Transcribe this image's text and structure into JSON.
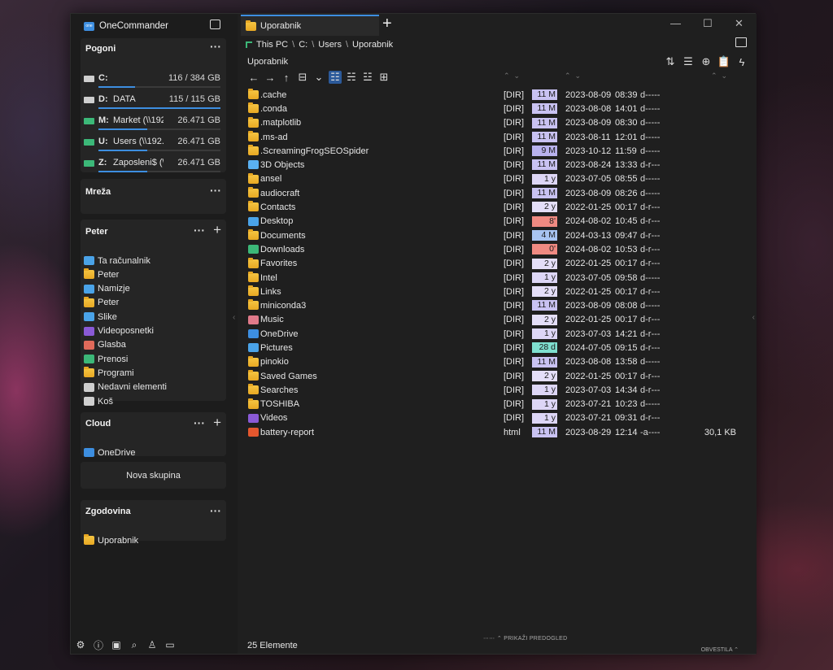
{
  "app": {
    "title": "OneCommander",
    "logo_text": "one"
  },
  "drives_group": {
    "title": "Pogoni",
    "drives": [
      {
        "letter": "C:",
        "name": "",
        "size": "116 / 384 GB",
        "fill": 0.3
      },
      {
        "letter": "D:",
        "name": "DATA",
        "size": "115 / 115 GB",
        "fill": 1.0
      },
      {
        "letter": "M:",
        "name": "Market (\\\\192.1...",
        "size": "26.471 GB",
        "fill": 0.4
      },
      {
        "letter": "U:",
        "name": "Users (\\\\192.168...",
        "size": "26.471 GB",
        "fill": 0.4
      },
      {
        "letter": "Z:",
        "name": "Zaposleni$ (\\\\1...",
        "size": "26.471 GB",
        "fill": 0.4
      }
    ]
  },
  "network_group": {
    "title": "Mreža"
  },
  "user_group": {
    "title": "Peter",
    "items": [
      {
        "label": "Ta računalnik",
        "icon": "monitor-icon",
        "color": "#4aa3e8"
      },
      {
        "label": "Peter",
        "icon": "folder-icon",
        "color": "#f2b632"
      },
      {
        "label": "Namizje",
        "icon": "desktop-icon",
        "color": "#4aa3e8"
      },
      {
        "label": "Peter",
        "icon": "folder-icon",
        "color": "#f2b632"
      },
      {
        "label": "Slike",
        "icon": "pictures-icon",
        "color": "#4aa3e8"
      },
      {
        "label": "Videoposnetki",
        "icon": "videos-icon",
        "color": "#8a5ad6"
      },
      {
        "label": "Glasba",
        "icon": "music-icon",
        "color": "#e06a5a"
      },
      {
        "label": "Prenosi",
        "icon": "downloads-icon",
        "color": "#3cb878"
      },
      {
        "label": "Programi",
        "icon": "folder-icon",
        "color": "#f2b632"
      },
      {
        "label": "Nedavni elementi",
        "icon": "recent-icon",
        "color": "#cfcfcf"
      },
      {
        "label": "Koš",
        "icon": "recycle-bin-icon",
        "color": "#cfcfcf"
      }
    ]
  },
  "cloud_group": {
    "title": "Cloud",
    "items": [
      {
        "label": "OneDrive",
        "icon": "onedrive-icon",
        "color": "#3d8ee0"
      }
    ]
  },
  "new_group_label": "Nova skupina",
  "history_group": {
    "title": "Zgodovina",
    "items": [
      {
        "label": "Uporabnik",
        "icon": "folder-icon",
        "color": "#f2b632"
      }
    ]
  },
  "tab": {
    "label": "Uporabnik"
  },
  "breadcrumb": [
    "This PC",
    "C:",
    "Users",
    "Uporabnik"
  ],
  "pane_title": "Uporabnik",
  "files": [
    {
      "name": ".cache",
      "type": "[DIR]",
      "age": "11 M",
      "age_color": "#c9c2f2",
      "date": "2023-08-09",
      "time": "08:39",
      "attr": "d-----",
      "size": "",
      "icon": "folder"
    },
    {
      "name": ".conda",
      "type": "[DIR]",
      "age": "11 M",
      "age_color": "#c9c2f2",
      "date": "2023-08-08",
      "time": "14:01",
      "attr": "d-----",
      "size": "",
      "icon": "folder"
    },
    {
      "name": ".matplotlib",
      "type": "[DIR]",
      "age": "11 M",
      "age_color": "#c9c2f2",
      "date": "2023-08-09",
      "time": "08:30",
      "attr": "d-----",
      "size": "",
      "icon": "folder"
    },
    {
      "name": ".ms-ad",
      "type": "[DIR]",
      "age": "11 M",
      "age_color": "#c9c2f2",
      "date": "2023-08-11",
      "time": "12:01",
      "attr": "d-----",
      "size": "",
      "icon": "folder"
    },
    {
      "name": ".ScreamingFrogSEOSpider",
      "type": "[DIR]",
      "age": "9 M",
      "age_color": "#b9b2ee",
      "date": "2023-10-12",
      "time": "11:59",
      "attr": "d-----",
      "size": "",
      "icon": "folder"
    },
    {
      "name": "3D Objects",
      "type": "[DIR]",
      "age": "11 M",
      "age_color": "#c9c2f2",
      "date": "2023-08-24",
      "time": "13:33",
      "attr": "d-r---",
      "size": "",
      "icon": "3d"
    },
    {
      "name": "ansel",
      "type": "[DIR]",
      "age": "1 y",
      "age_color": "#ddd6f6",
      "date": "2023-07-05",
      "time": "08:55",
      "attr": "d-----",
      "size": "",
      "icon": "folder"
    },
    {
      "name": "audiocraft",
      "type": "[DIR]",
      "age": "11 M",
      "age_color": "#c9c2f2",
      "date": "2023-08-09",
      "time": "08:26",
      "attr": "d-----",
      "size": "",
      "icon": "folder"
    },
    {
      "name": "Contacts",
      "type": "[DIR]",
      "age": "2 y",
      "age_color": "#e4def8",
      "date": "2022-01-25",
      "time": "00:17",
      "attr": "d-r---",
      "size": "",
      "icon": "folder"
    },
    {
      "name": "Desktop",
      "type": "[DIR]",
      "age": "8'",
      "age_color": "#f08a82",
      "date": "2024-08-02",
      "time": "10:45",
      "attr": "d-r---",
      "size": "",
      "icon": "desktop"
    },
    {
      "name": "Documents",
      "type": "[DIR]",
      "age": "4 M",
      "age_color": "#a8c4f2",
      "date": "2024-03-13",
      "time": "09:47",
      "attr": "d-r---",
      "size": "",
      "icon": "folder"
    },
    {
      "name": "Downloads",
      "type": "[DIR]",
      "age": "0'",
      "age_color": "#f08a82",
      "date": "2024-08-02",
      "time": "10:53",
      "attr": "d-r---",
      "size": "",
      "icon": "download"
    },
    {
      "name": "Favorites",
      "type": "[DIR]",
      "age": "2 y",
      "age_color": "#e4def8",
      "date": "2022-01-25",
      "time": "00:17",
      "attr": "d-r---",
      "size": "",
      "icon": "folder"
    },
    {
      "name": "Intel",
      "type": "[DIR]",
      "age": "1 y",
      "age_color": "#ddd6f6",
      "date": "2023-07-05",
      "time": "09:58",
      "attr": "d-----",
      "size": "",
      "icon": "folder"
    },
    {
      "name": "Links",
      "type": "[DIR]",
      "age": "2 y",
      "age_color": "#e4def8",
      "date": "2022-01-25",
      "time": "00:17",
      "attr": "d-r---",
      "size": "",
      "icon": "folder"
    },
    {
      "name": "miniconda3",
      "type": "[DIR]",
      "age": "11 M",
      "age_color": "#c9c2f2",
      "date": "2023-08-09",
      "time": "08:08",
      "attr": "d-----",
      "size": "",
      "icon": "folder"
    },
    {
      "name": "Music",
      "type": "[DIR]",
      "age": "2 y",
      "age_color": "#e4def8",
      "date": "2022-01-25",
      "time": "00:17",
      "attr": "d-r---",
      "size": "",
      "icon": "music"
    },
    {
      "name": "OneDrive",
      "type": "[DIR]",
      "age": "1 y",
      "age_color": "#ddd6f6",
      "date": "2023-07-03",
      "time": "14:21",
      "attr": "d-r---",
      "size": "",
      "icon": "onedrive"
    },
    {
      "name": "Pictures",
      "type": "[DIR]",
      "age": "28 d",
      "age_color": "#7fe0d0",
      "date": "2024-07-05",
      "time": "09:15",
      "attr": "d-r---",
      "size": "",
      "icon": "pictures"
    },
    {
      "name": "pinokio",
      "type": "[DIR]",
      "age": "11 M",
      "age_color": "#c9c2f2",
      "date": "2023-08-08",
      "time": "13:58",
      "attr": "d-----",
      "size": "",
      "icon": "folder"
    },
    {
      "name": "Saved Games",
      "type": "[DIR]",
      "age": "2 y",
      "age_color": "#e4def8",
      "date": "2022-01-25",
      "time": "00:17",
      "attr": "d-r---",
      "size": "",
      "icon": "folder"
    },
    {
      "name": "Searches",
      "type": "[DIR]",
      "age": "1 y",
      "age_color": "#ddd6f6",
      "date": "2023-07-03",
      "time": "14:34",
      "attr": "d-r---",
      "size": "",
      "icon": "folder"
    },
    {
      "name": "TOSHIBA",
      "type": "[DIR]",
      "age": "1 y",
      "age_color": "#ddd6f6",
      "date": "2023-07-21",
      "time": "10:23",
      "attr": "d-----",
      "size": "",
      "icon": "folder"
    },
    {
      "name": "Videos",
      "type": "[DIR]",
      "age": "1 y",
      "age_color": "#ddd6f6",
      "date": "2023-07-21",
      "time": "09:31",
      "attr": "d-r---",
      "size": "",
      "icon": "videos"
    },
    {
      "name": "battery-report",
      "type": "html",
      "age": "11 M",
      "age_color": "#c9c2f2",
      "date": "2023-08-29",
      "time": "12:14",
      "attr": "-a----",
      "size": "30,1 KB",
      "icon": "html"
    }
  ],
  "status": {
    "count": "25 Elemente",
    "preview": "PRIKAŽI PREDOGLED",
    "notifications": "OBVESTILA"
  },
  "colors": {
    "accent": "#3d8ee0",
    "folder": "#f2b632",
    "bg": "#1f1f1f"
  }
}
